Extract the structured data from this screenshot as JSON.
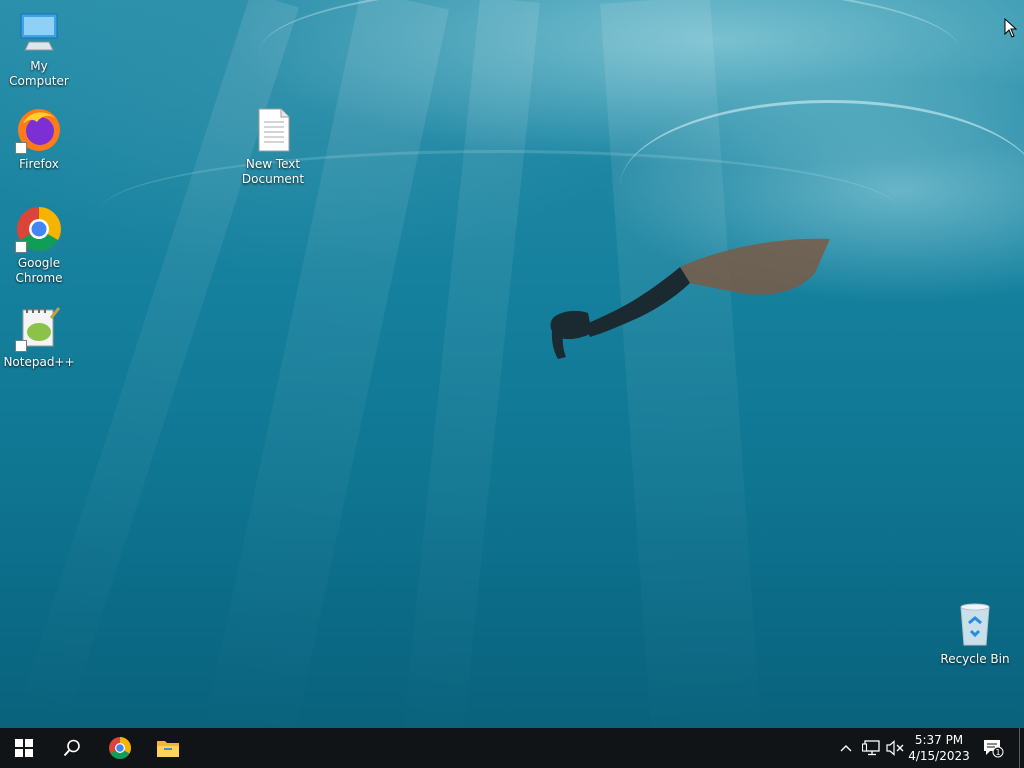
{
  "desktop": {
    "icons": [
      {
        "label": "My Computer",
        "icon": "computer-icon"
      },
      {
        "label": "Firefox",
        "icon": "firefox-icon"
      },
      {
        "label": "Google Chrome",
        "icon": "chrome-icon"
      },
      {
        "label": "Notepad++",
        "icon": "notepad-plus-plus-icon"
      },
      {
        "label": "New Text Document",
        "icon": "text-document-icon"
      },
      {
        "label": "Recycle Bin",
        "icon": "recycle-bin-icon"
      }
    ]
  },
  "taskbar": {
    "buttons": [
      "windows-start-icon",
      "search-icon",
      "chrome-icon",
      "file-explorer-icon"
    ],
    "tray_icons": [
      "chevron-up-icon",
      "network-icon",
      "volume-muted-icon"
    ],
    "clock": {
      "time": "5:37 PM",
      "date": "4/15/2023"
    },
    "notifications": {
      "count": "1",
      "icon": "action-center-icon"
    }
  },
  "colors": {
    "taskbar_bg": "#101416",
    "water_top": "#2a90ab",
    "water_bottom": "#0a627c"
  }
}
